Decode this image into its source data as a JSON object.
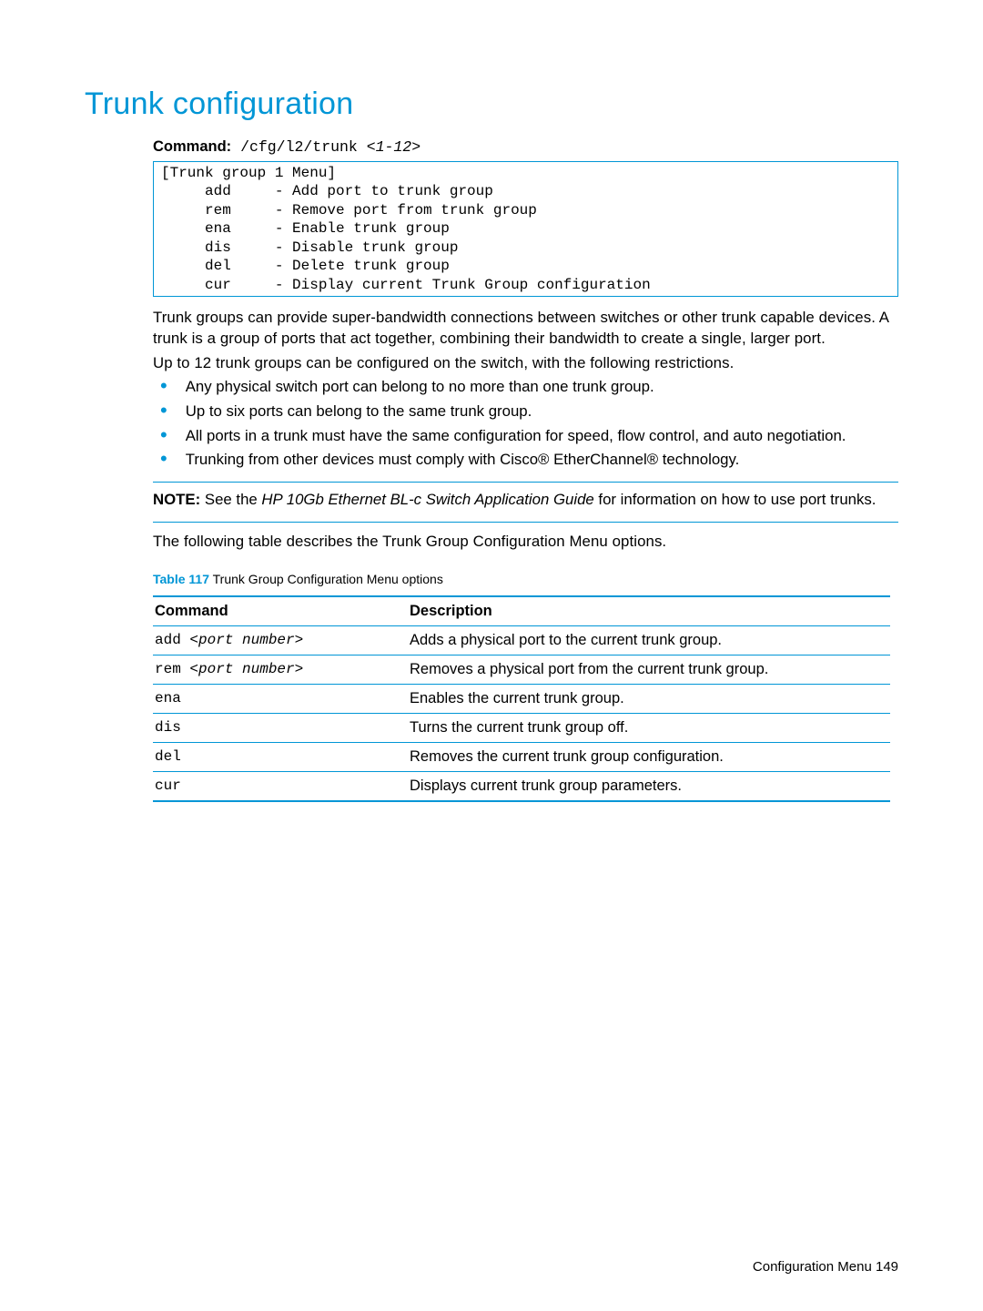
{
  "title": "Trunk configuration",
  "command_label": "Command:",
  "command_path": " /cfg/l2/trunk ",
  "command_arg": "<1-12>",
  "menu_lines": [
    "[Trunk group 1 Menu]",
    "     add     - Add port to trunk group",
    "     rem     - Remove port from trunk group",
    "     ena     - Enable trunk group",
    "     dis     - Disable trunk group",
    "     del     - Delete trunk group",
    "     cur     - Display current Trunk Group configuration"
  ],
  "para1": "Trunk groups can provide super-bandwidth connections between switches or other trunk capable devices. A trunk is a group of ports that act together, combining their bandwidth to create a single, larger port.",
  "para2": "Up to 12 trunk groups can be configured on the switch, with the following restrictions.",
  "bullets": [
    "Any physical switch port can belong to no more than one trunk group.",
    "Up to six ports can belong to the same trunk group.",
    "All ports in a trunk must have the same configuration for speed, flow control, and auto negotiation.",
    "Trunking from other devices must comply with Cisco® EtherChannel® technology."
  ],
  "note_label": "NOTE:",
  "note_prefix": " See the ",
  "note_italic": "HP 10Gb Ethernet BL-c Switch Application Guide",
  "note_suffix": " for information on how to use port trunks.",
  "para3": "The following table describes the Trunk Group Configuration Menu options.",
  "table_caption_label": "Table 117",
  "table_caption_text": "  Trunk Group Configuration Menu options",
  "table_headers": {
    "cmd": "Command",
    "desc": "Description"
  },
  "table_rows": [
    {
      "cmd_prefix": "add ",
      "cmd_arg": "<port number>",
      "desc": "Adds a physical port to the current trunk group."
    },
    {
      "cmd_prefix": "rem ",
      "cmd_arg": "<port number>",
      "desc": "Removes a physical port from the current trunk group."
    },
    {
      "cmd_prefix": "ena",
      "cmd_arg": "",
      "desc": "Enables the current trunk group."
    },
    {
      "cmd_prefix": "dis",
      "cmd_arg": "",
      "desc": "Turns the current trunk group off."
    },
    {
      "cmd_prefix": "del",
      "cmd_arg": "",
      "desc": "Removes the current trunk group configuration."
    },
    {
      "cmd_prefix": "cur",
      "cmd_arg": "",
      "desc": "Displays current trunk group parameters."
    }
  ],
  "footer_text": "Configuration Menu   149"
}
